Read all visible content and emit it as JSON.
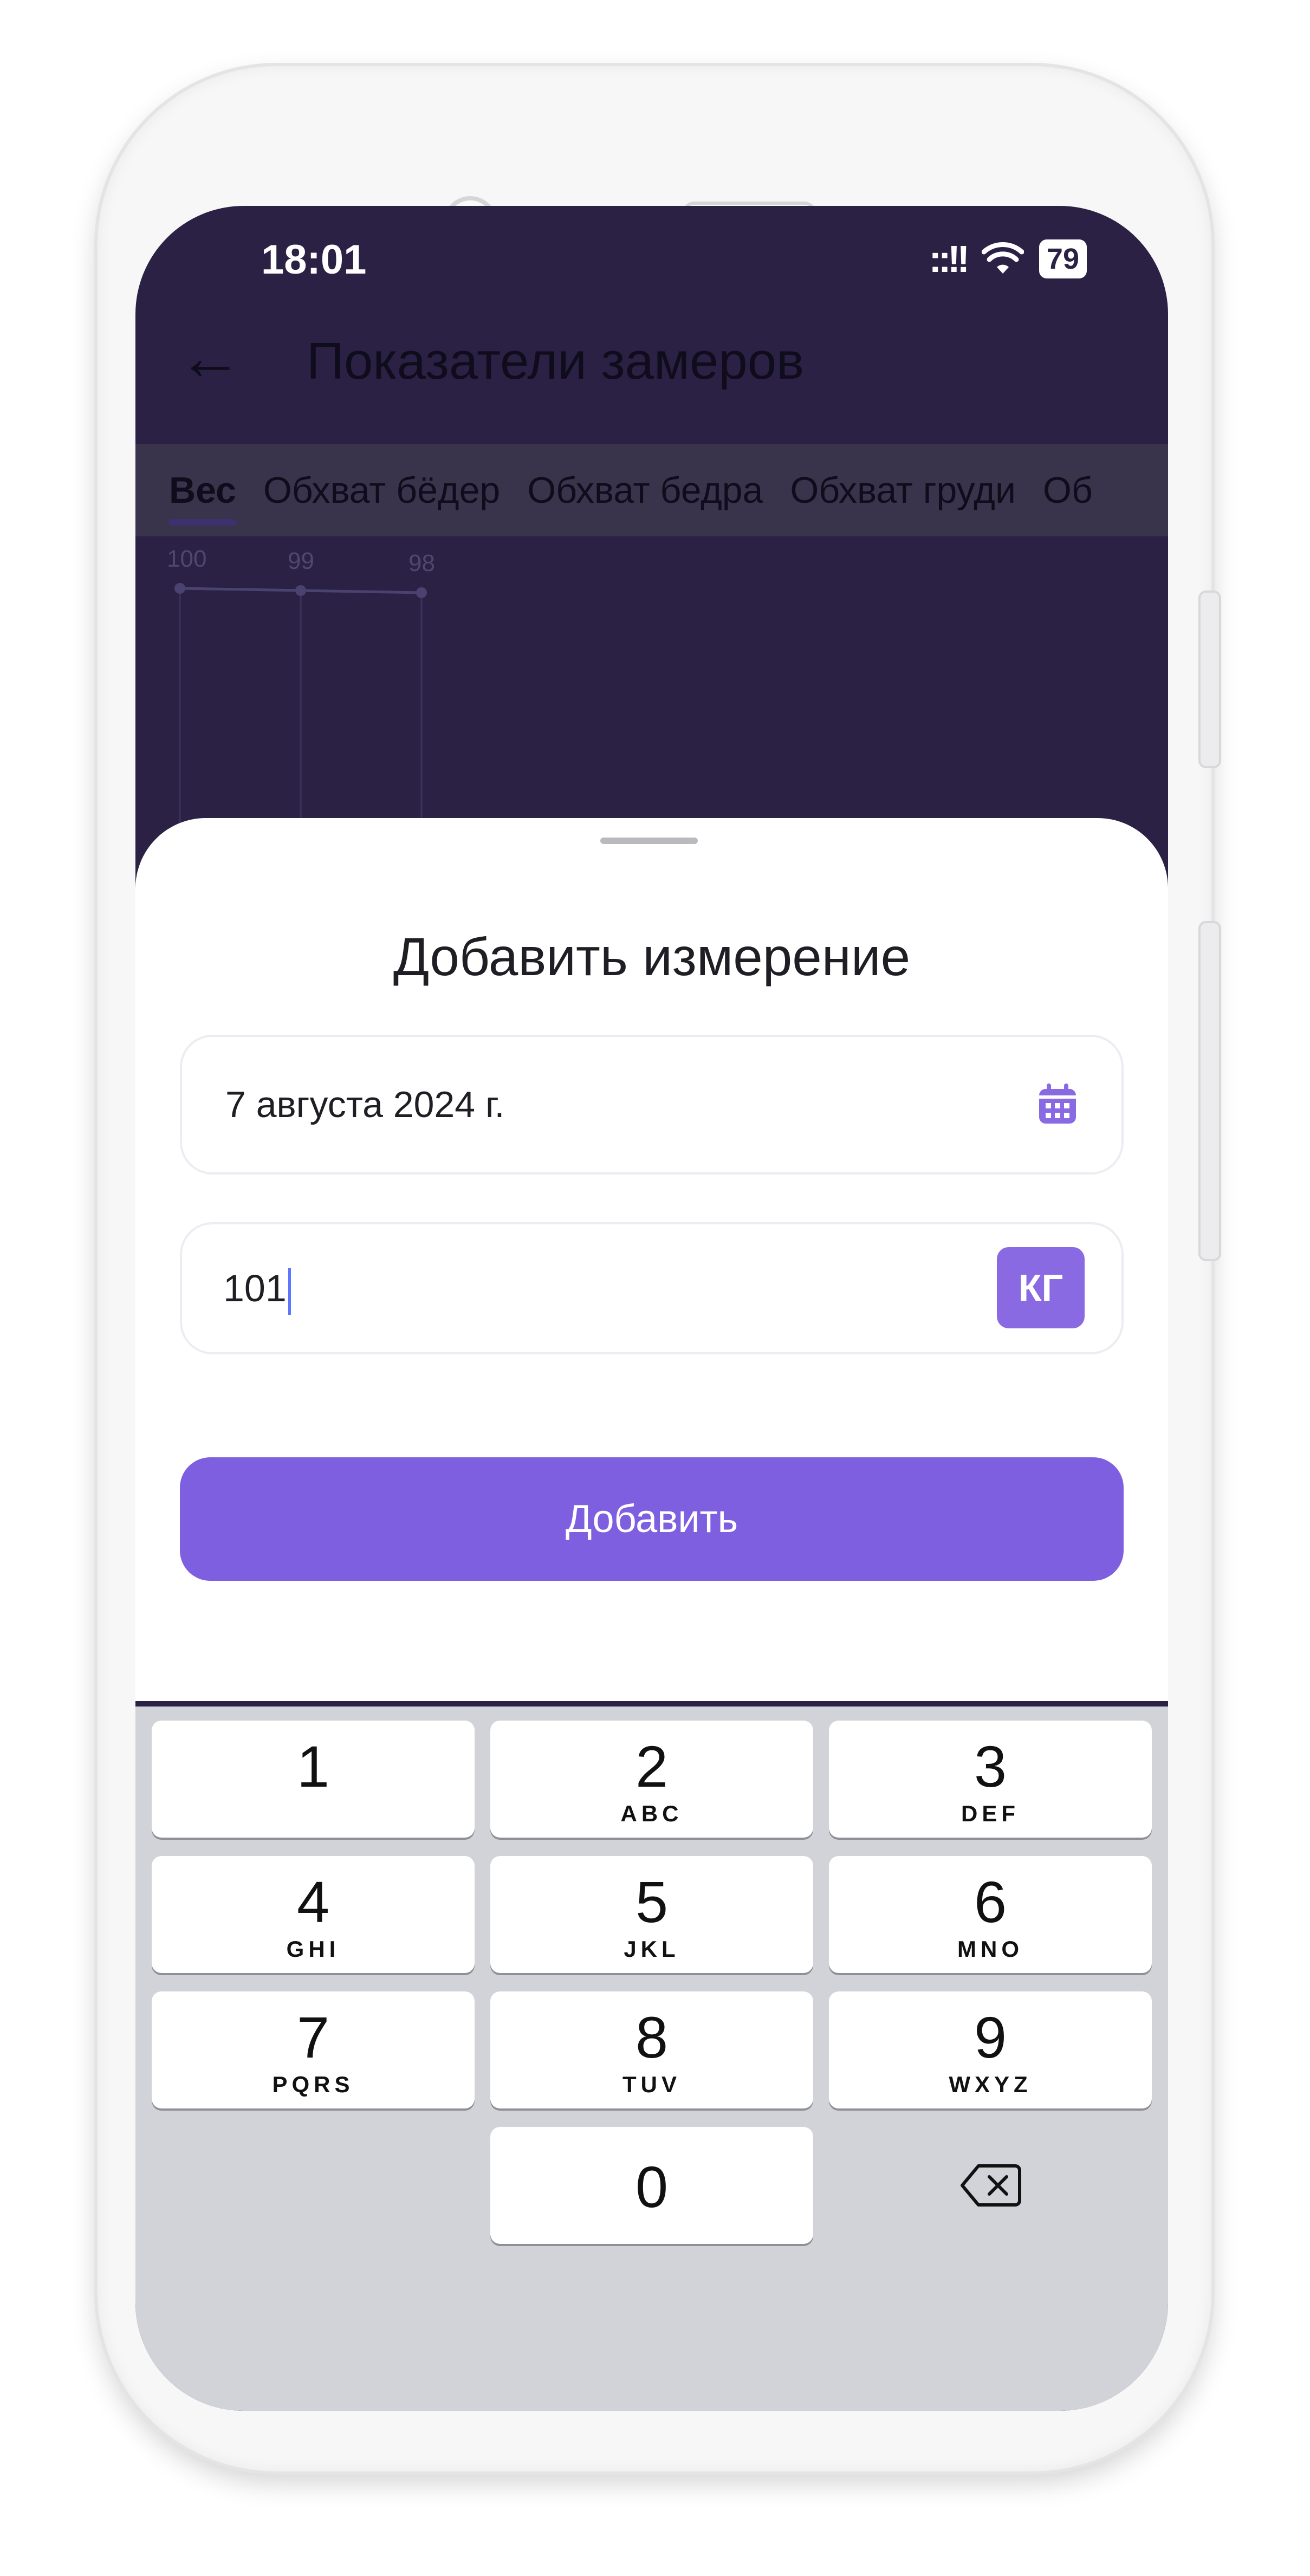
{
  "status_bar": {
    "time": "18:01",
    "signal": "::!!",
    "battery": "79"
  },
  "app_bar": {
    "back_icon": "arrow-left-icon",
    "title": "Показатели замеров"
  },
  "tabs": [
    {
      "label": "Вес",
      "active": true
    },
    {
      "label": "Обхват бёдер"
    },
    {
      "label": "Обхват бедра"
    },
    {
      "label": "Обхват груди"
    },
    {
      "label": "Об"
    }
  ],
  "chart_data": {
    "type": "line",
    "values": [
      100,
      99,
      98
    ],
    "labels": [
      "100",
      "99",
      "98"
    ]
  },
  "sheet": {
    "title": "Добавить измерение",
    "date_value": "7 августа 2024 г.",
    "calendar_icon": "calendar-icon",
    "measurement_value": "101",
    "unit_label": "КГ",
    "submit_label": "Добавить"
  },
  "keyboard": {
    "keys": [
      {
        "num": "1",
        "letters": ""
      },
      {
        "num": "2",
        "letters": "ABC"
      },
      {
        "num": "3",
        "letters": "DEF"
      },
      {
        "num": "4",
        "letters": "GHI"
      },
      {
        "num": "5",
        "letters": "JKL"
      },
      {
        "num": "6",
        "letters": "MNO"
      },
      {
        "num": "7",
        "letters": "PQRS"
      },
      {
        "num": "8",
        "letters": "TUV"
      },
      {
        "num": "9",
        "letters": "WXYZ"
      },
      {
        "num": "0",
        "letters": ""
      }
    ],
    "delete_icon": "backspace-icon"
  },
  "colors": {
    "accent": "#7d5fe0",
    "header_bg": "#2a2145"
  }
}
